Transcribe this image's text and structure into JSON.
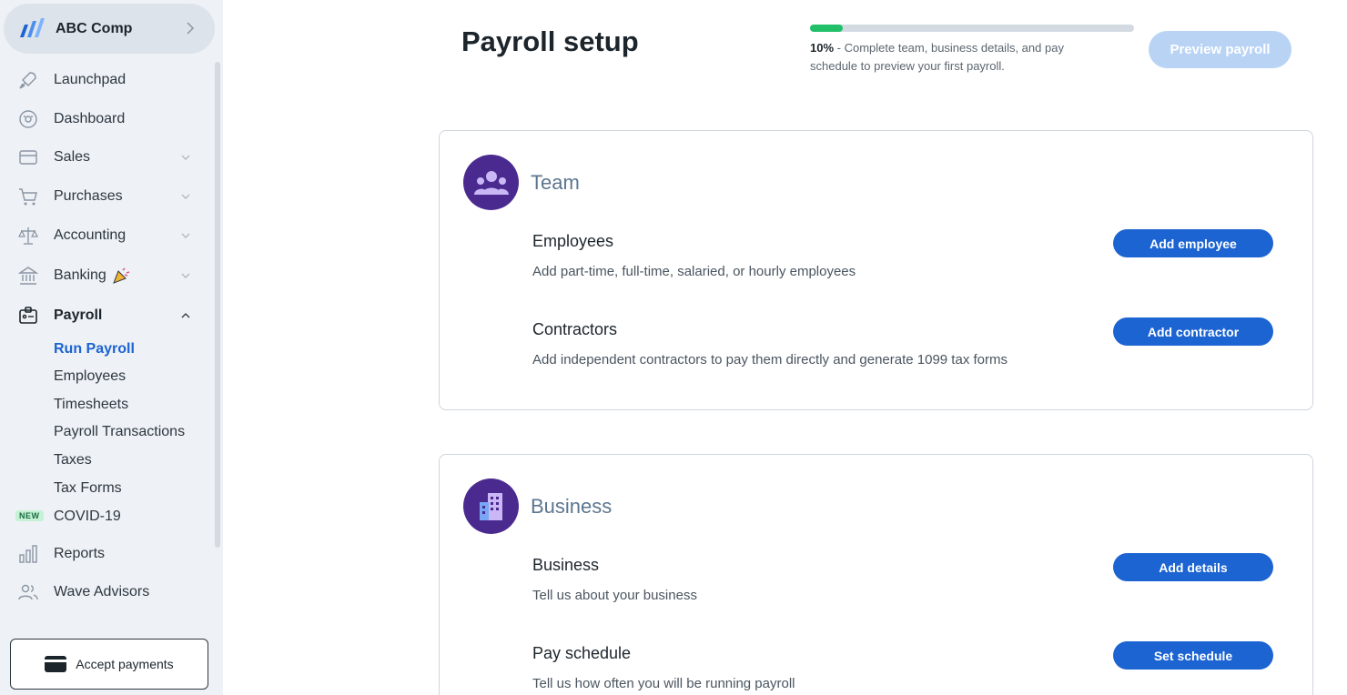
{
  "company": {
    "name": "ABC Comp"
  },
  "nav": {
    "launchpad": "Launchpad",
    "dashboard": "Dashboard",
    "sales": "Sales",
    "purchases": "Purchases",
    "accounting": "Accounting",
    "banking": "Banking",
    "payroll": "Payroll",
    "payroll_sub": {
      "run_payroll": "Run Payroll",
      "employees": "Employees",
      "timesheets": "Timesheets",
      "payroll_transactions": "Payroll Transactions",
      "taxes": "Taxes",
      "tax_forms": "Tax Forms"
    },
    "covid_badge": "NEW",
    "covid": "COVID-19",
    "reports": "Reports",
    "wave_advisors": "Wave Advisors"
  },
  "accept_payments": "Accept payments",
  "header": {
    "title": "Payroll setup",
    "progress_percent": 10,
    "progress_label": "10%",
    "progress_message": " - Complete team, business details, and pay schedule to preview your first payroll.",
    "preview_button": "Preview payroll"
  },
  "team_card": {
    "title": "Team",
    "employees_title": "Employees",
    "employees_desc": "Add part-time, full-time, salaried, or hourly employees",
    "employees_button": "Add employee",
    "contractors_title": "Contractors",
    "contractors_desc": "Add independent contractors to pay them directly and generate 1099 tax forms",
    "contractors_button": "Add contractor"
  },
  "business_card": {
    "title": "Business",
    "business_title": "Business",
    "business_desc": "Tell us about your business",
    "business_button": "Add details",
    "schedule_title": "Pay schedule",
    "schedule_desc": "Tell us how often you will be running payroll",
    "schedule_button": "Set schedule"
  },
  "colors": {
    "primary": "#1c64d2",
    "progress": "#23c06a",
    "card_icon": "#4b2a8f",
    "sidebar_bg": "#eef1f5"
  }
}
